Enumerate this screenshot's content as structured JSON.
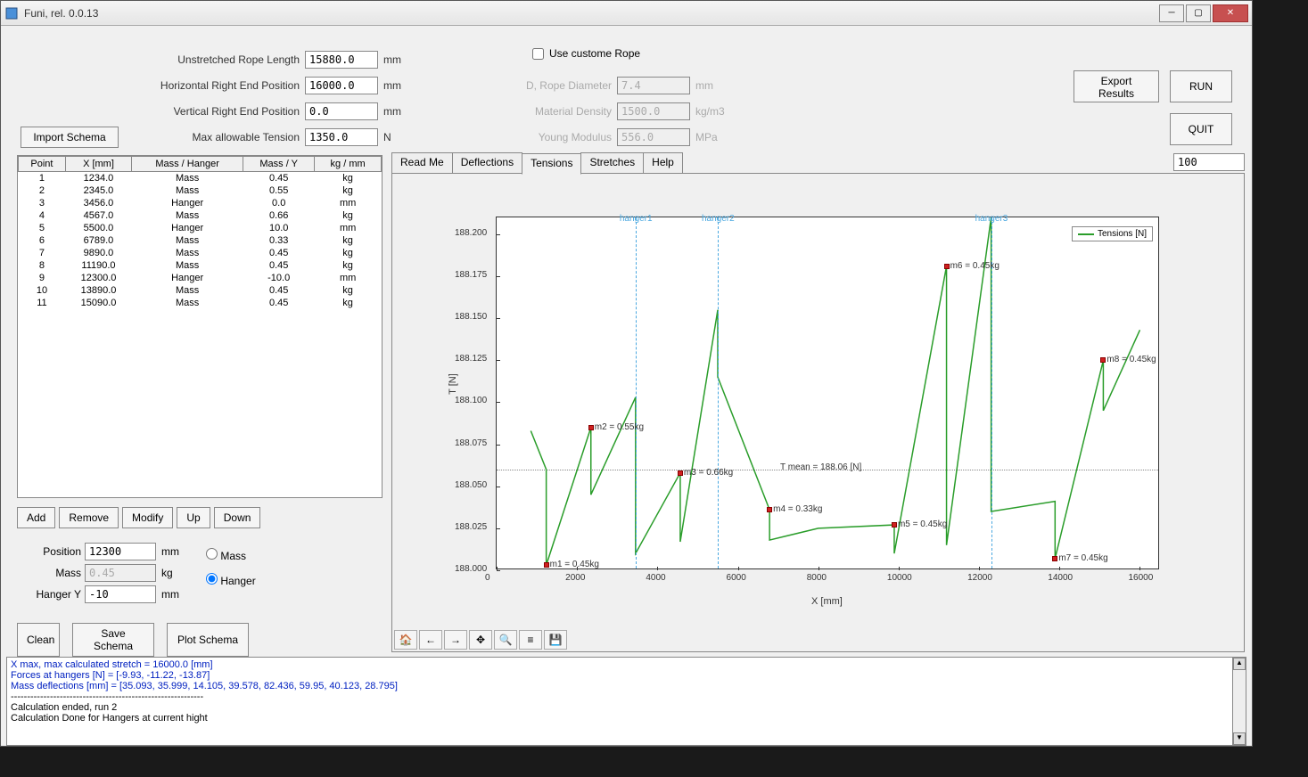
{
  "window": {
    "title": "Funi, rel. 0.0.13"
  },
  "form": {
    "unstretched_label": "Unstretched Rope Length",
    "unstretched_value": "15880.0",
    "unstretched_unit": "mm",
    "hriz_label": "Horizontal Right End Position",
    "hriz_value": "16000.0",
    "hriz_unit": "mm",
    "vert_label": "Vertical Right End Position",
    "vert_value": "0.0",
    "vert_unit": "mm",
    "maxt_label": "Max allowable Tension",
    "maxt_value": "1350.0",
    "maxt_unit": "N",
    "custom_rope_label": "Use custome Rope",
    "diam_label": "D, Rope Diameter",
    "diam_value": "7.4",
    "diam_unit": "mm",
    "dens_label": "Material Density",
    "dens_value": "1500.0",
    "dens_unit": "kg/m3",
    "ym_label": "Young Modulus",
    "ym_value": "556.0",
    "ym_unit": "MPa"
  },
  "buttons": {
    "import_schema": "Import Schema",
    "export_results": "Export Results",
    "run": "RUN",
    "quit": "QUIT",
    "add": "Add",
    "remove": "Remove",
    "modify": "Modify",
    "up": "Up",
    "down": "Down",
    "clean": "Clean",
    "save_schema": "Save Schema",
    "plot_schema": "Plot Schema"
  },
  "table": {
    "headers": [
      "Point",
      "X [mm]",
      "Mass / Hanger",
      "Mass / Y",
      "kg / mm"
    ],
    "rows": [
      [
        "1",
        "1234.0",
        "Mass",
        "0.45",
        "kg"
      ],
      [
        "2",
        "2345.0",
        "Mass",
        "0.55",
        "kg"
      ],
      [
        "3",
        "3456.0",
        "Hanger",
        "0.0",
        "mm"
      ],
      [
        "4",
        "4567.0",
        "Mass",
        "0.66",
        "kg"
      ],
      [
        "5",
        "5500.0",
        "Hanger",
        "10.0",
        "mm"
      ],
      [
        "6",
        "6789.0",
        "Mass",
        "0.33",
        "kg"
      ],
      [
        "7",
        "9890.0",
        "Mass",
        "0.45",
        "kg"
      ],
      [
        "8",
        "11190.0",
        "Mass",
        "0.45",
        "kg"
      ],
      [
        "9",
        "12300.0",
        "Hanger",
        "-10.0",
        "mm"
      ],
      [
        "10",
        "13890.0",
        "Mass",
        "0.45",
        "kg"
      ],
      [
        "11",
        "15090.0",
        "Mass",
        "0.45",
        "kg"
      ]
    ]
  },
  "edit": {
    "position_label": "Position",
    "position_value": "12300",
    "position_unit": "mm",
    "mass_label": "Mass",
    "mass_value": "0.45",
    "mass_unit": "kg",
    "hangery_label": "Hanger Y",
    "hangery_value": "-10",
    "hangery_unit": "mm",
    "radio_mass": "Mass",
    "radio_hanger": "Hanger"
  },
  "tabs": {
    "readme": "Read Me",
    "deflections": "Deflections",
    "tensions": "Tensions",
    "stretches": "Stretches",
    "help": "Help"
  },
  "dpi_value": "100",
  "chart_data": {
    "type": "line",
    "title": "",
    "xlabel": "X  [mm]",
    "ylabel": "T  [N]",
    "xlim": [
      0,
      16500
    ],
    "ylim": [
      188.0,
      188.21
    ],
    "xticks": [
      0,
      2000,
      4000,
      6000,
      8000,
      10000,
      12000,
      14000,
      16000
    ],
    "yticks": [
      188.0,
      188.025,
      188.05,
      188.075,
      188.1,
      188.125,
      188.15,
      188.175,
      188.2
    ],
    "legend": "Tensions [N]",
    "tmean_label": "T mean = 188.06 [N]",
    "tmean_value": 188.06,
    "hangers": [
      {
        "label": "hanger1",
        "x": 3456
      },
      {
        "label": "hanger2",
        "x": 5500
      },
      {
        "label": "hanger3",
        "x": 12300
      }
    ],
    "markers": [
      {
        "label": "m1 = 0.45kg",
        "x": 1234,
        "y": 188.003
      },
      {
        "label": "m2 = 0.55kg",
        "x": 2345,
        "y": 188.085
      },
      {
        "label": "m3 = 0.66kg",
        "x": 4567,
        "y": 188.058
      },
      {
        "label": "m4 = 0.33kg",
        "x": 6789,
        "y": 188.036
      },
      {
        "label": "m5 = 0.45kg",
        "x": 9890,
        "y": 188.027
      },
      {
        "label": "m6 = 0.45kg",
        "x": 11190,
        "y": 188.181
      },
      {
        "label": "m7 = 0.45kg",
        "x": 13890,
        "y": 188.007
      },
      {
        "label": "m8 = 0.45kg",
        "x": 15090,
        "y": 188.125
      }
    ],
    "polyline": [
      [
        850,
        188.083
      ],
      [
        1234,
        188.06
      ],
      [
        1234,
        188.003
      ],
      [
        2345,
        188.085
      ],
      [
        2345,
        188.045
      ],
      [
        3456,
        188.103
      ],
      [
        3456,
        188.01
      ],
      [
        4567,
        188.058
      ],
      [
        4567,
        188.017
      ],
      [
        5500,
        188.155
      ],
      [
        5500,
        188.115
      ],
      [
        6789,
        188.036
      ],
      [
        6789,
        188.018
      ],
      [
        8000,
        188.025
      ],
      [
        9890,
        188.027
      ],
      [
        9890,
        188.01
      ],
      [
        11190,
        188.181
      ],
      [
        11190,
        188.015
      ],
      [
        12300,
        188.21
      ],
      [
        12300,
        188.035
      ],
      [
        13890,
        188.041
      ],
      [
        13890,
        188.007
      ],
      [
        15090,
        188.125
      ],
      [
        15090,
        188.095
      ],
      [
        16000,
        188.143
      ]
    ]
  },
  "log": {
    "lines": [
      {
        "c": "blue",
        "t": "X max, max calculated stretch = 16000.0 [mm]"
      },
      {
        "c": "blue",
        "t": "Forces at hangers [N] = [-9.93, -11.22, -13.87]"
      },
      {
        "c": "blue",
        "t": "Mass deflections [mm] = [35.093, 35.999, 14.105, 39.578, 82.436, 59.95, 40.123, 28.795]"
      },
      {
        "c": "",
        "t": ""
      },
      {
        "c": "",
        "t": "-----------------------------------------------------------"
      },
      {
        "c": "",
        "t": "Calculation ended, run 2"
      },
      {
        "c": "",
        "t": "Calculation Done for Hangers at current hight"
      }
    ]
  }
}
